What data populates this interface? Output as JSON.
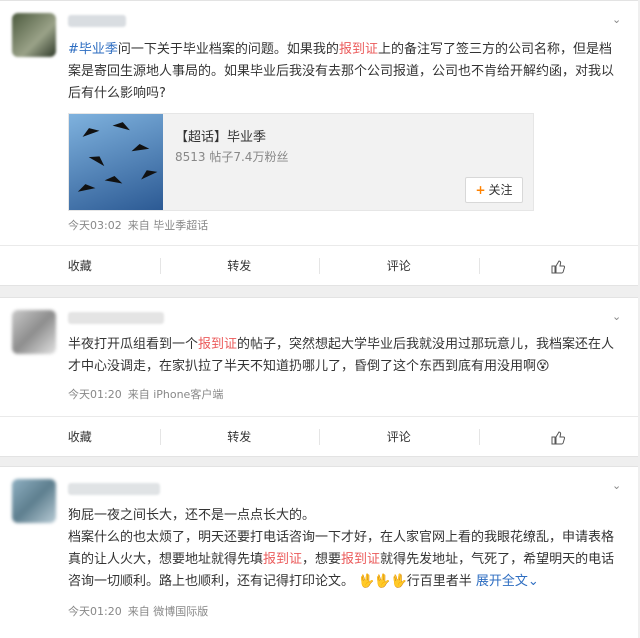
{
  "posts": [
    {
      "topic_tag": "毕业季",
      "text_parts": [
        "问一下关于毕业档案的问题。如果我的",
        "报到证",
        "上的备注写了签三方的公司名称，但是档案是寄回生源地人事局的。如果毕业后我没有去那个公司报道，公司也不肯给开解约函，对我以后有什么影响吗?"
      ],
      "topic_card": {
        "title": "【超话】毕业季",
        "stats": "8513 帖子7.4万粉丝",
        "follow_label": "关注"
      },
      "time": "今天03:02",
      "source": "来自 毕业季超话",
      "actions": [
        "收藏",
        "转发",
        "评论"
      ]
    },
    {
      "text_parts": [
        "半夜打开瓜组看到一个",
        "报到证",
        "的帖子，突然想起大学毕业后我就没用过那玩意儿，我档案还在人才中心没调走，在家扒拉了半天不知道扔哪儿了，昏倒了这个东西到底有用没用啊"
      ],
      "time": "今天01:20",
      "source": "来自 iPhone客户端",
      "actions": [
        "收藏",
        "转发",
        "评论"
      ]
    },
    {
      "line1": "狗屁一夜之间长大，还不是一点点长大的。",
      "text_parts": [
        "档案什么的也太烦了，明天还要打电话咨询一下才好，在人家官网上看的我眼花缭乱，申请表格真的让人火大，想要地址就得先填",
        "报到证",
        "，想要",
        "报到证",
        "就得先发地址，气死了，希望明天的电话咨询一切顺利。路上也顺利，还有记得打印论文。"
      ],
      "tail_text": "行百里者半",
      "expand_label": "展开全文",
      "time": "今天01:20",
      "source": "来自 微博国际版"
    }
  ]
}
